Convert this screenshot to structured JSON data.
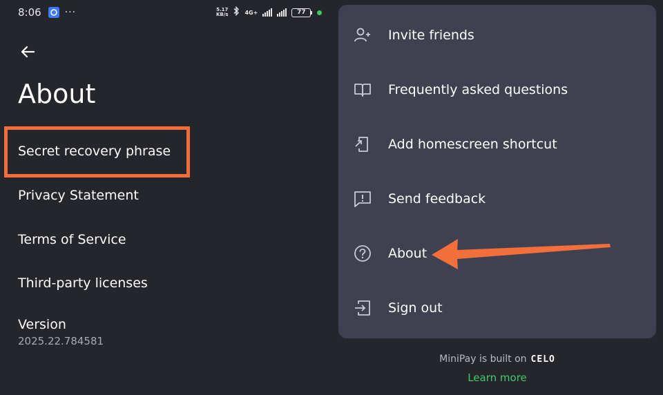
{
  "status_bar": {
    "time": "8:06",
    "menu_dots": "···",
    "net_speed_value": "5.17",
    "net_speed_unit": "KB/s",
    "network": "4G+",
    "battery": "77"
  },
  "about_page": {
    "title": "About",
    "items": [
      {
        "label": "Secret recovery phrase"
      },
      {
        "label": "Privacy Statement"
      },
      {
        "label": "Terms of Service"
      },
      {
        "label": "Third-party licenses"
      }
    ],
    "version_label": "Version",
    "version_value": "2025.22.784581"
  },
  "menu": {
    "items": [
      {
        "label": "Invite friends",
        "icon": "person-add-icon"
      },
      {
        "label": "Frequently asked questions",
        "icon": "book-icon"
      },
      {
        "label": "Add homescreen shortcut",
        "icon": "phone-shortcut-icon"
      },
      {
        "label": "Send feedback",
        "icon": "feedback-icon"
      },
      {
        "label": "About",
        "icon": "help-circle-icon"
      },
      {
        "label": "Sign out",
        "icon": "sign-out-icon"
      }
    ]
  },
  "footer": {
    "built_on": "MiniPay is built on",
    "brand": "CELO",
    "learn_more": "Learn more"
  },
  "colors": {
    "background": "#24262c",
    "menu_card": "#3f4150",
    "annotation_orange": "#f26f3c",
    "link_green": "#3fcb6a"
  }
}
